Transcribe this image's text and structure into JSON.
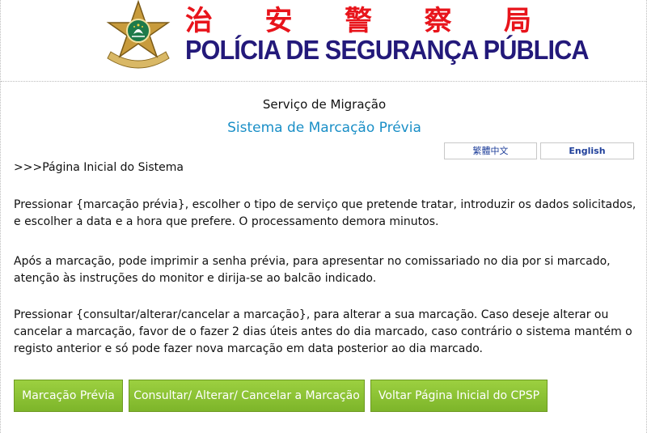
{
  "header": {
    "chinese_title": [
      "治",
      "安",
      "警",
      "察",
      "局"
    ],
    "portuguese_title": "POLÍCIA DE SEGURANÇA PÚBLICA"
  },
  "titles": {
    "service": "Serviço de Migração",
    "system": "Sistema de Marcação Prévia"
  },
  "language": {
    "chinese_label": "繁體中文",
    "english_label": "English"
  },
  "breadcrumb": ">>>Página Inicial do Sistema",
  "paragraphs": [
    "Pressionar {marcação prévia}, escolher o tipo de serviço que pretende tratar, introduzir os dados solicitados, e escolher a data e a hora que prefere. O processamento demora minutos.",
    "Após a marcação, pode imprimir a senha prévia, para apresentar no comissariado no dia por si marcado, atenção às instruções do monitor e dirija-se ao balcão indicado.",
    "Pressionar {consultar/alterar/cancelar a marcação}, para alterar a sua marcação. Caso deseje alterar ou cancelar a marcação, favor de o fazer 2 dias úteis antes do dia marcado, caso contrário o sistema mantém o registo anterior e só pode fazer nova marcação em data posterior ao dia marcado."
  ],
  "buttons": {
    "book": "Marcação Prévia",
    "consult": "Consultar/ Alterar/ Cancelar a Marcação",
    "back": "Voltar Página Inicial do CPSP"
  },
  "colors": {
    "chinese_title": "#e8141b",
    "portuguese_title": "#23197a",
    "system_title": "#1a8fc7",
    "button_green": "#8cc43a"
  },
  "icons": {
    "emblem": "police-star-emblem-icon"
  }
}
